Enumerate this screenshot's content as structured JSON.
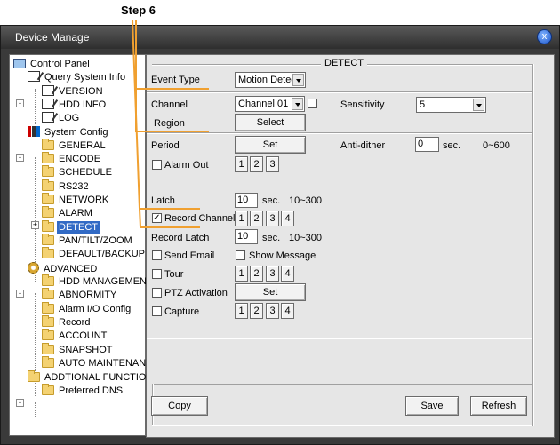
{
  "annotation": {
    "step_label": "Step 6"
  },
  "window": {
    "title": "Device Manage",
    "close_glyph": "x"
  },
  "tree": {
    "items": [
      {
        "label": "Control Panel",
        "icon": "pc-icon"
      },
      {
        "label": "Query System Info",
        "icon": "doc-icon"
      },
      {
        "label": "VERSION",
        "icon": "doc-icon"
      },
      {
        "label": "HDD INFO",
        "icon": "doc-icon"
      },
      {
        "label": "LOG",
        "icon": "doc-icon"
      },
      {
        "label": "System Config",
        "icon": "system-icon"
      },
      {
        "label": "GENERAL",
        "icon": "folder-icon"
      },
      {
        "label": "ENCODE",
        "icon": "folder-icon"
      },
      {
        "label": "SCHEDULE",
        "icon": "folder-icon"
      },
      {
        "label": "RS232",
        "icon": "folder-icon"
      },
      {
        "label": "NETWORK",
        "icon": "folder-icon"
      },
      {
        "label": "ALARM",
        "icon": "folder-icon"
      },
      {
        "label": "DETECT",
        "icon": "folder-icon"
      },
      {
        "label": "PAN/TILT/ZOOM",
        "icon": "folder-icon"
      },
      {
        "label": "DEFAULT/BACKUP",
        "icon": "folder-icon"
      },
      {
        "label": "ADVANCED",
        "icon": "gear-icon"
      },
      {
        "label": "HDD MANAGEMENT",
        "icon": "folder-icon"
      },
      {
        "label": "ABNORMITY",
        "icon": "folder-icon"
      },
      {
        "label": "Alarm I/O Config",
        "icon": "folder-icon"
      },
      {
        "label": "Record",
        "icon": "folder-icon"
      },
      {
        "label": "ACCOUNT",
        "icon": "folder-icon"
      },
      {
        "label": "SNAPSHOT",
        "icon": "folder-icon"
      },
      {
        "label": "AUTO MAINTENANCI",
        "icon": "folder-icon"
      },
      {
        "label": "ADDTIONAL FUNCTION",
        "icon": "folder-icon"
      },
      {
        "label": "Preferred DNS",
        "icon": "folder-icon"
      }
    ],
    "expanders": {
      "minus": "-",
      "plus": "+"
    }
  },
  "detect": {
    "section_title": "DETECT",
    "event_type_label": "Event Type",
    "event_type_value": "Motion Detect",
    "channel_label": "Channel",
    "channel_value": "Channel 01",
    "sensitivity_label": "Sensitivity",
    "sensitivity_value": "5",
    "region_label": "Region",
    "region_button": "Select",
    "period_label": "Period",
    "period_button": "Set",
    "anti_dither_label": "Anti-dither",
    "anti_dither_value": "0",
    "anti_dither_unit": "sec.",
    "anti_dither_range": "0~600",
    "alarm_out_label": "Alarm Out",
    "latch_label": "Latch",
    "latch_value": "10",
    "latch_unit": "sec.",
    "latch_range": "10~300",
    "record_channel_label": "Record Channel",
    "record_channel_checked": "✓",
    "record_latch_label": "Record Latch",
    "record_latch_value": "10",
    "record_latch_unit": "sec.",
    "record_latch_range": "10~300",
    "send_email_label": "Send Email",
    "show_message_label": "Show Message",
    "tour_label": "Tour",
    "ptz_label": "PTZ Activation",
    "ptz_button": "Set",
    "capture_label": "Capture",
    "num": [
      "1",
      "2",
      "3",
      "4"
    ],
    "copy_button": "Copy",
    "save_button": "Save",
    "refresh_button": "Refresh"
  },
  "colors": {
    "highlight": "#316ac5",
    "annotation": "#f0a030"
  }
}
